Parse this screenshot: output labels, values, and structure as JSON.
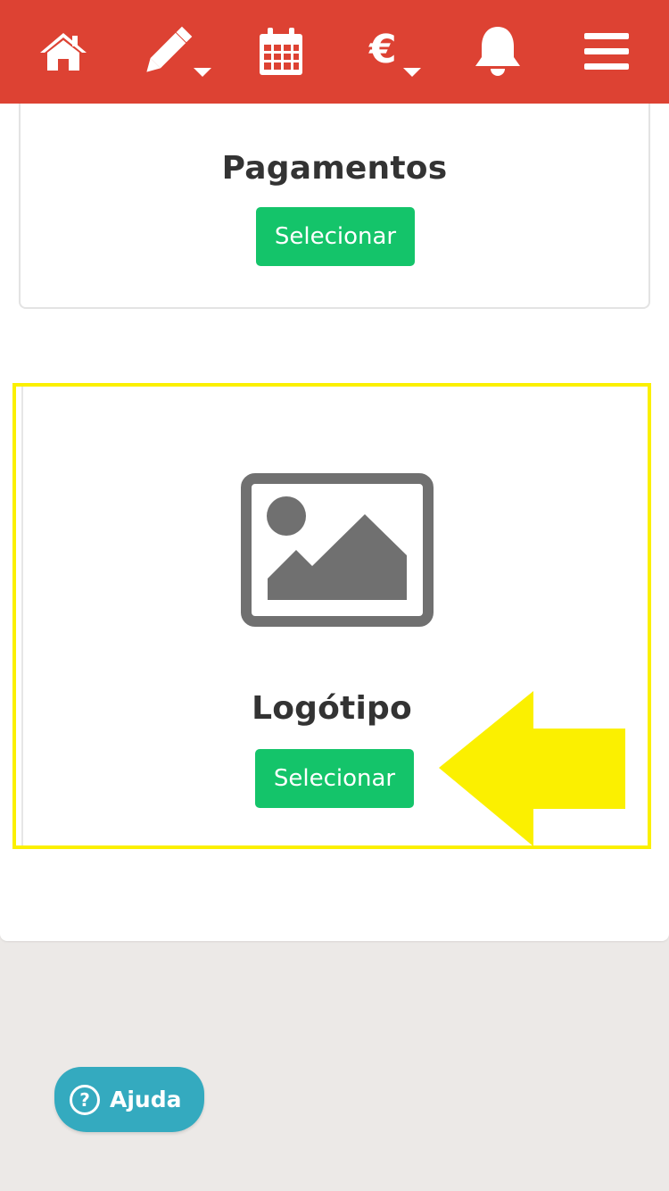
{
  "navbar": {
    "background": "#dd4233",
    "icons": [
      "home-icon",
      "edit-dropdown-icon",
      "calendar-icon",
      "euro-dropdown-icon",
      "bell-icon",
      "menu-icon"
    ]
  },
  "payments_card": {
    "title": "Pagamentos",
    "button_label": "Selecionar"
  },
  "logo_card": {
    "image_icon": "image-placeholder-icon",
    "title": "Logótipo",
    "button_label": "Selecionar",
    "highlight_color": "#fbf000"
  },
  "annotation": {
    "arrow_icon": "pointer-arrow-icon",
    "color": "#fbf000"
  },
  "help": {
    "label": "Ajuda",
    "icon_glyph": "?"
  },
  "colors": {
    "accent_green": "#14c46a",
    "help_teal": "#34aabf",
    "background": "#ece9e7"
  }
}
